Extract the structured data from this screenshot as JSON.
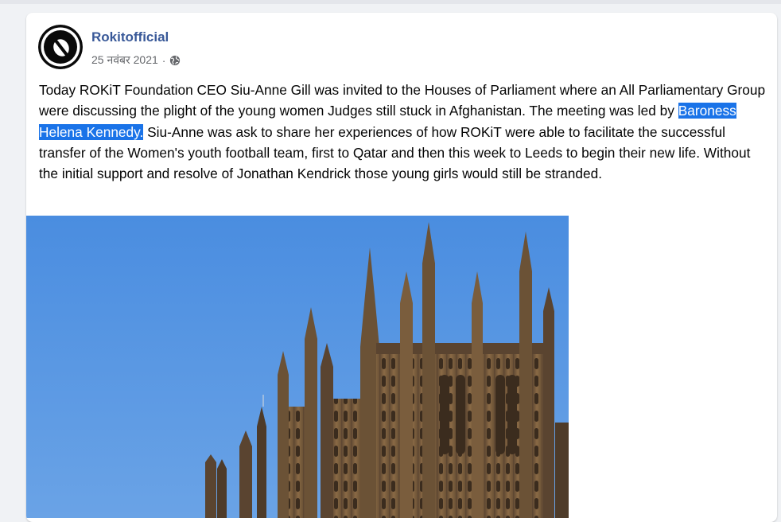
{
  "post": {
    "author": "Rokitofficial",
    "date": "25 नवंबर 2021",
    "separator": "·",
    "privacy_icon": "globe-icon",
    "avatar_icon": "rokit-logo-icon",
    "text_before": "Today ROKiT Foundation CEO Siu-Anne Gill was invited to the Houses of Parliament where an All Parliamentary Group were discussing the plight of the young women Judges still stuck in Afghanistan. The meeting was led by ",
    "text_highlight": "Baroness Helena Kennedy.",
    "text_after": " Siu-Anne was ask to share her experiences of how ROKiT were able to facilitate the successful transfer of the Women's youth football team, first to Qatar and then this week to Leeds to begin their new life. Without the initial support and resolve of Jonathan Kendrick those young girls would still be stranded."
  },
  "colors": {
    "author": "#385898",
    "highlight": "#1a73e8",
    "sky": "#4a8de0",
    "stone": "#8a6a45"
  }
}
